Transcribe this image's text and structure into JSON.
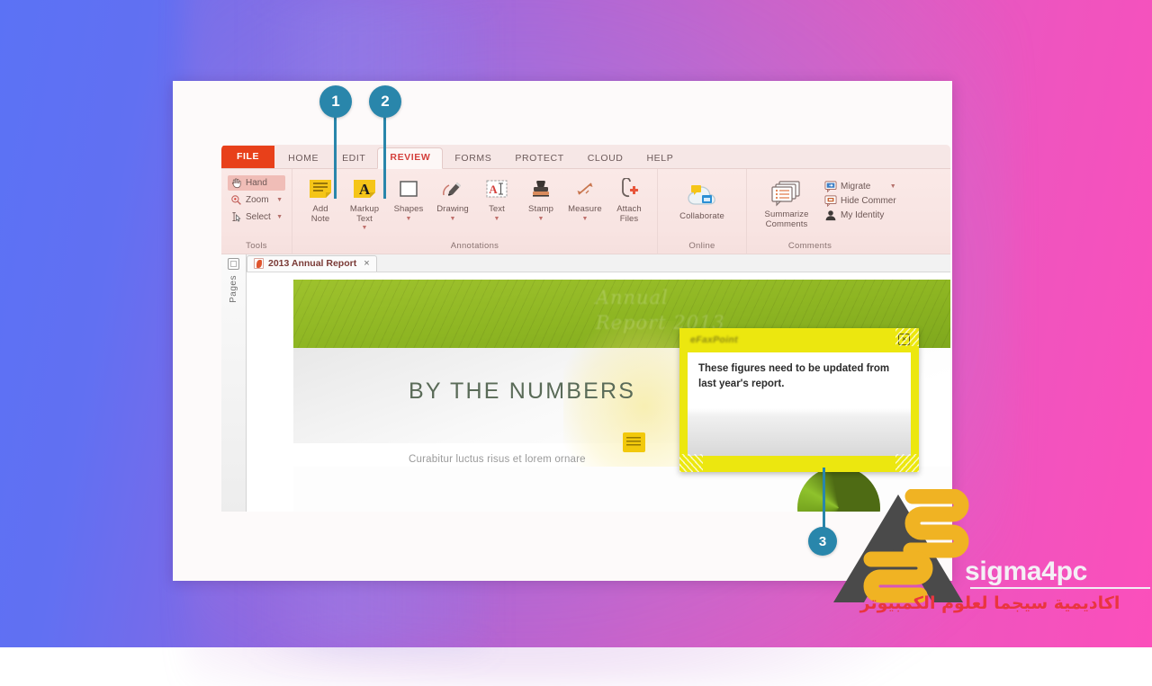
{
  "ribbon": {
    "tabs": [
      {
        "label": "FILE",
        "kind": "file"
      },
      {
        "label": "HOME",
        "kind": "normal"
      },
      {
        "label": "EDIT",
        "kind": "normal"
      },
      {
        "label": "REVIEW",
        "kind": "active"
      },
      {
        "label": "FORMS",
        "kind": "normal"
      },
      {
        "label": "PROTECT",
        "kind": "normal"
      },
      {
        "label": "CLOUD",
        "kind": "normal"
      },
      {
        "label": "HELP",
        "kind": "normal"
      }
    ],
    "groups": {
      "tools": {
        "label": "Tools",
        "items": [
          {
            "label": "Hand",
            "icon": "hand-icon",
            "selected": true,
            "dropdown": false
          },
          {
            "label": "Zoom",
            "icon": "magnifier-icon",
            "selected": false,
            "dropdown": true
          },
          {
            "label": "Select",
            "icon": "text-select-icon",
            "selected": false,
            "dropdown": true
          }
        ]
      },
      "annotations": {
        "label": "Annotations",
        "items": [
          {
            "label": "Add\nNote",
            "icon": "sticky-note-icon",
            "dropdown": false
          },
          {
            "label": "Markup\nText",
            "icon": "highlight-a-icon",
            "dropdown": true
          },
          {
            "label": "Shapes",
            "icon": "square-shape-icon",
            "dropdown": true
          },
          {
            "label": "Drawing",
            "icon": "pencil-icon",
            "dropdown": true
          },
          {
            "label": "Text",
            "icon": "text-box-icon",
            "dropdown": true
          },
          {
            "label": "Stamp",
            "icon": "stamp-icon",
            "dropdown": true
          },
          {
            "label": "Measure",
            "icon": "measure-icon",
            "dropdown": true
          },
          {
            "label": "Attach\nFiles",
            "icon": "attach-file-icon",
            "dropdown": false
          }
        ]
      },
      "online": {
        "label": "Online",
        "items": [
          {
            "label": "Collaborate",
            "icon": "cloud-collaborate-icon",
            "dropdown": false
          }
        ]
      },
      "comments": {
        "label": "Comments",
        "big": {
          "label": "Summarize\nComments",
          "icon": "summarize-comments-icon",
          "dropdown": true
        },
        "small": [
          {
            "label": "Migrate",
            "icon": "migrate-comments-icon",
            "dropdown": true
          },
          {
            "label": "Hide Commer",
            "icon": "hide-comments-icon",
            "dropdown": false
          },
          {
            "label": "My Identity",
            "icon": "user-identity-icon",
            "dropdown": false
          }
        ]
      }
    }
  },
  "document": {
    "tab": {
      "title": "2013 Annual Report",
      "close": "×",
      "icon": "pdf-file-icon"
    },
    "pages_rail": {
      "label": "Pages",
      "icon": "page-thumbnails-icon"
    },
    "page": {
      "banner_watermark": "Annual\nReport 2013",
      "title": "BY THE NUMBERS",
      "subtitle": "Curabitur luctus risus et lorem ornare"
    }
  },
  "sticky_note": {
    "title": "eFaxPoint",
    "body": "These figures need to be updated from last year's report.",
    "close_glyph": "×",
    "color": "#ece70f"
  },
  "callouts": [
    {
      "number": "1"
    },
    {
      "number": "2"
    },
    {
      "number": "3"
    }
  ],
  "watermark": {
    "brand": "sigma4pc",
    "arabic": "اكاديمية سيجما لعلوم الكمبيوتر",
    "logo_icon": "sigma4pc-logo-icon"
  },
  "colors": {
    "badge": "#2986ab",
    "file_tab": "#e8401a",
    "active_tab_text": "#d4403c",
    "sticky": "#ece70f",
    "banner_green": "#8db522",
    "brand_red": "#e9353f"
  }
}
